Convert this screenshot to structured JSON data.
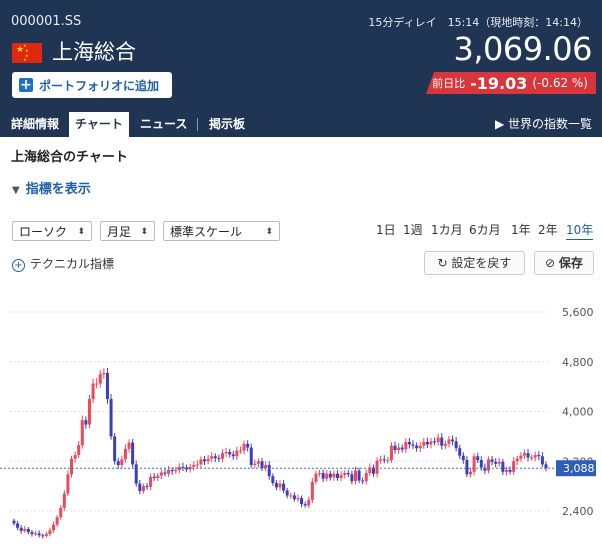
{
  "header": {
    "ticker": "000001.SS",
    "delay_info": "15分ディレイ　15:14（現地時刻：14:14）",
    "name": "上海総合",
    "price": "3,069.06",
    "portfolio_button": "ポートフォリオに追加",
    "change_label": "前日比",
    "change_value": "-19.03",
    "change_percent": "(-0.62 %)",
    "change_color": "#d8363c"
  },
  "tabs": [
    "詳細情報",
    "チャート",
    "ニュース",
    "掲示板"
  ],
  "active_tab": "チャート",
  "world_indices_link": "世界の指数一覧",
  "section_title": "上海総合のチャート",
  "indicator_toggle": "指標を表示",
  "controls": {
    "chart_type": "ローソク",
    "interval": "月足",
    "scale": "標準スケール",
    "periods": [
      "1日",
      "1週",
      "1カ月",
      "6カ月",
      "1年",
      "2年",
      "10年"
    ],
    "active_period": "10年",
    "technical_label": "テクニカル指標",
    "reset_button": "設定を戻す",
    "save_button": "保存"
  },
  "chart_data": {
    "type": "candlestick",
    "y_ticks": [
      "5,600",
      "4,800",
      "4,000",
      "3,200",
      "2,400"
    ],
    "ylim": [
      2000,
      5800
    ],
    "current_price_label": "3,088",
    "current_price": 3088,
    "up_color": "#f0485a",
    "down_color": "#3a3dbf",
    "grid": true,
    "close_series": [
      2200,
      2130,
      2080,
      2110,
      2060,
      2030,
      2040,
      2010,
      2000,
      2030,
      2090,
      2180,
      2300,
      2450,
      2680,
      2990,
      3240,
      3300,
      3460,
      3860,
      3790,
      4200,
      4450,
      4450,
      4600,
      4620,
      4200,
      3600,
      3200,
      3140,
      3230,
      3400,
      3500,
      3150,
      2840,
      2720,
      2800,
      2790,
      2950,
      2930,
      2970,
      3020,
      3000,
      3060,
      3040,
      3060,
      3110,
      3100,
      3070,
      3110,
      3140,
      3150,
      3230,
      3200,
      3240,
      3280,
      3250,
      3240,
      3330,
      3350,
      3310,
      3280,
      3370,
      3370,
      3480,
      3420,
      3140,
      3160,
      3200,
      3090,
      3140,
      2960,
      2850,
      2780,
      2840,
      2730,
      2650,
      2650,
      2590,
      2610,
      2510,
      2490,
      2580,
      2870,
      3000,
      3010,
      2920,
      3000,
      2940,
      3000,
      2930,
      2980,
      3010,
      2990,
      2880,
      3050,
      2890,
      2880,
      3010,
      3100,
      3000,
      3210,
      3230,
      3220,
      3220,
      3450,
      3380,
      3420,
      3390,
      3510,
      3470,
      3450,
      3410,
      3450,
      3510,
      3470,
      3520,
      3510,
      3580,
      3450,
      3480,
      3550,
      3520,
      3410,
      3290,
      3220,
      2990,
      3030,
      3280,
      3220,
      3100,
      3050,
      3230,
      3190,
      3160,
      3190,
      3030,
      3060,
      3030,
      3200,
      3240,
      3290,
      3330,
      3260,
      3260,
      3300,
      3280,
      3150,
      3090
    ]
  }
}
